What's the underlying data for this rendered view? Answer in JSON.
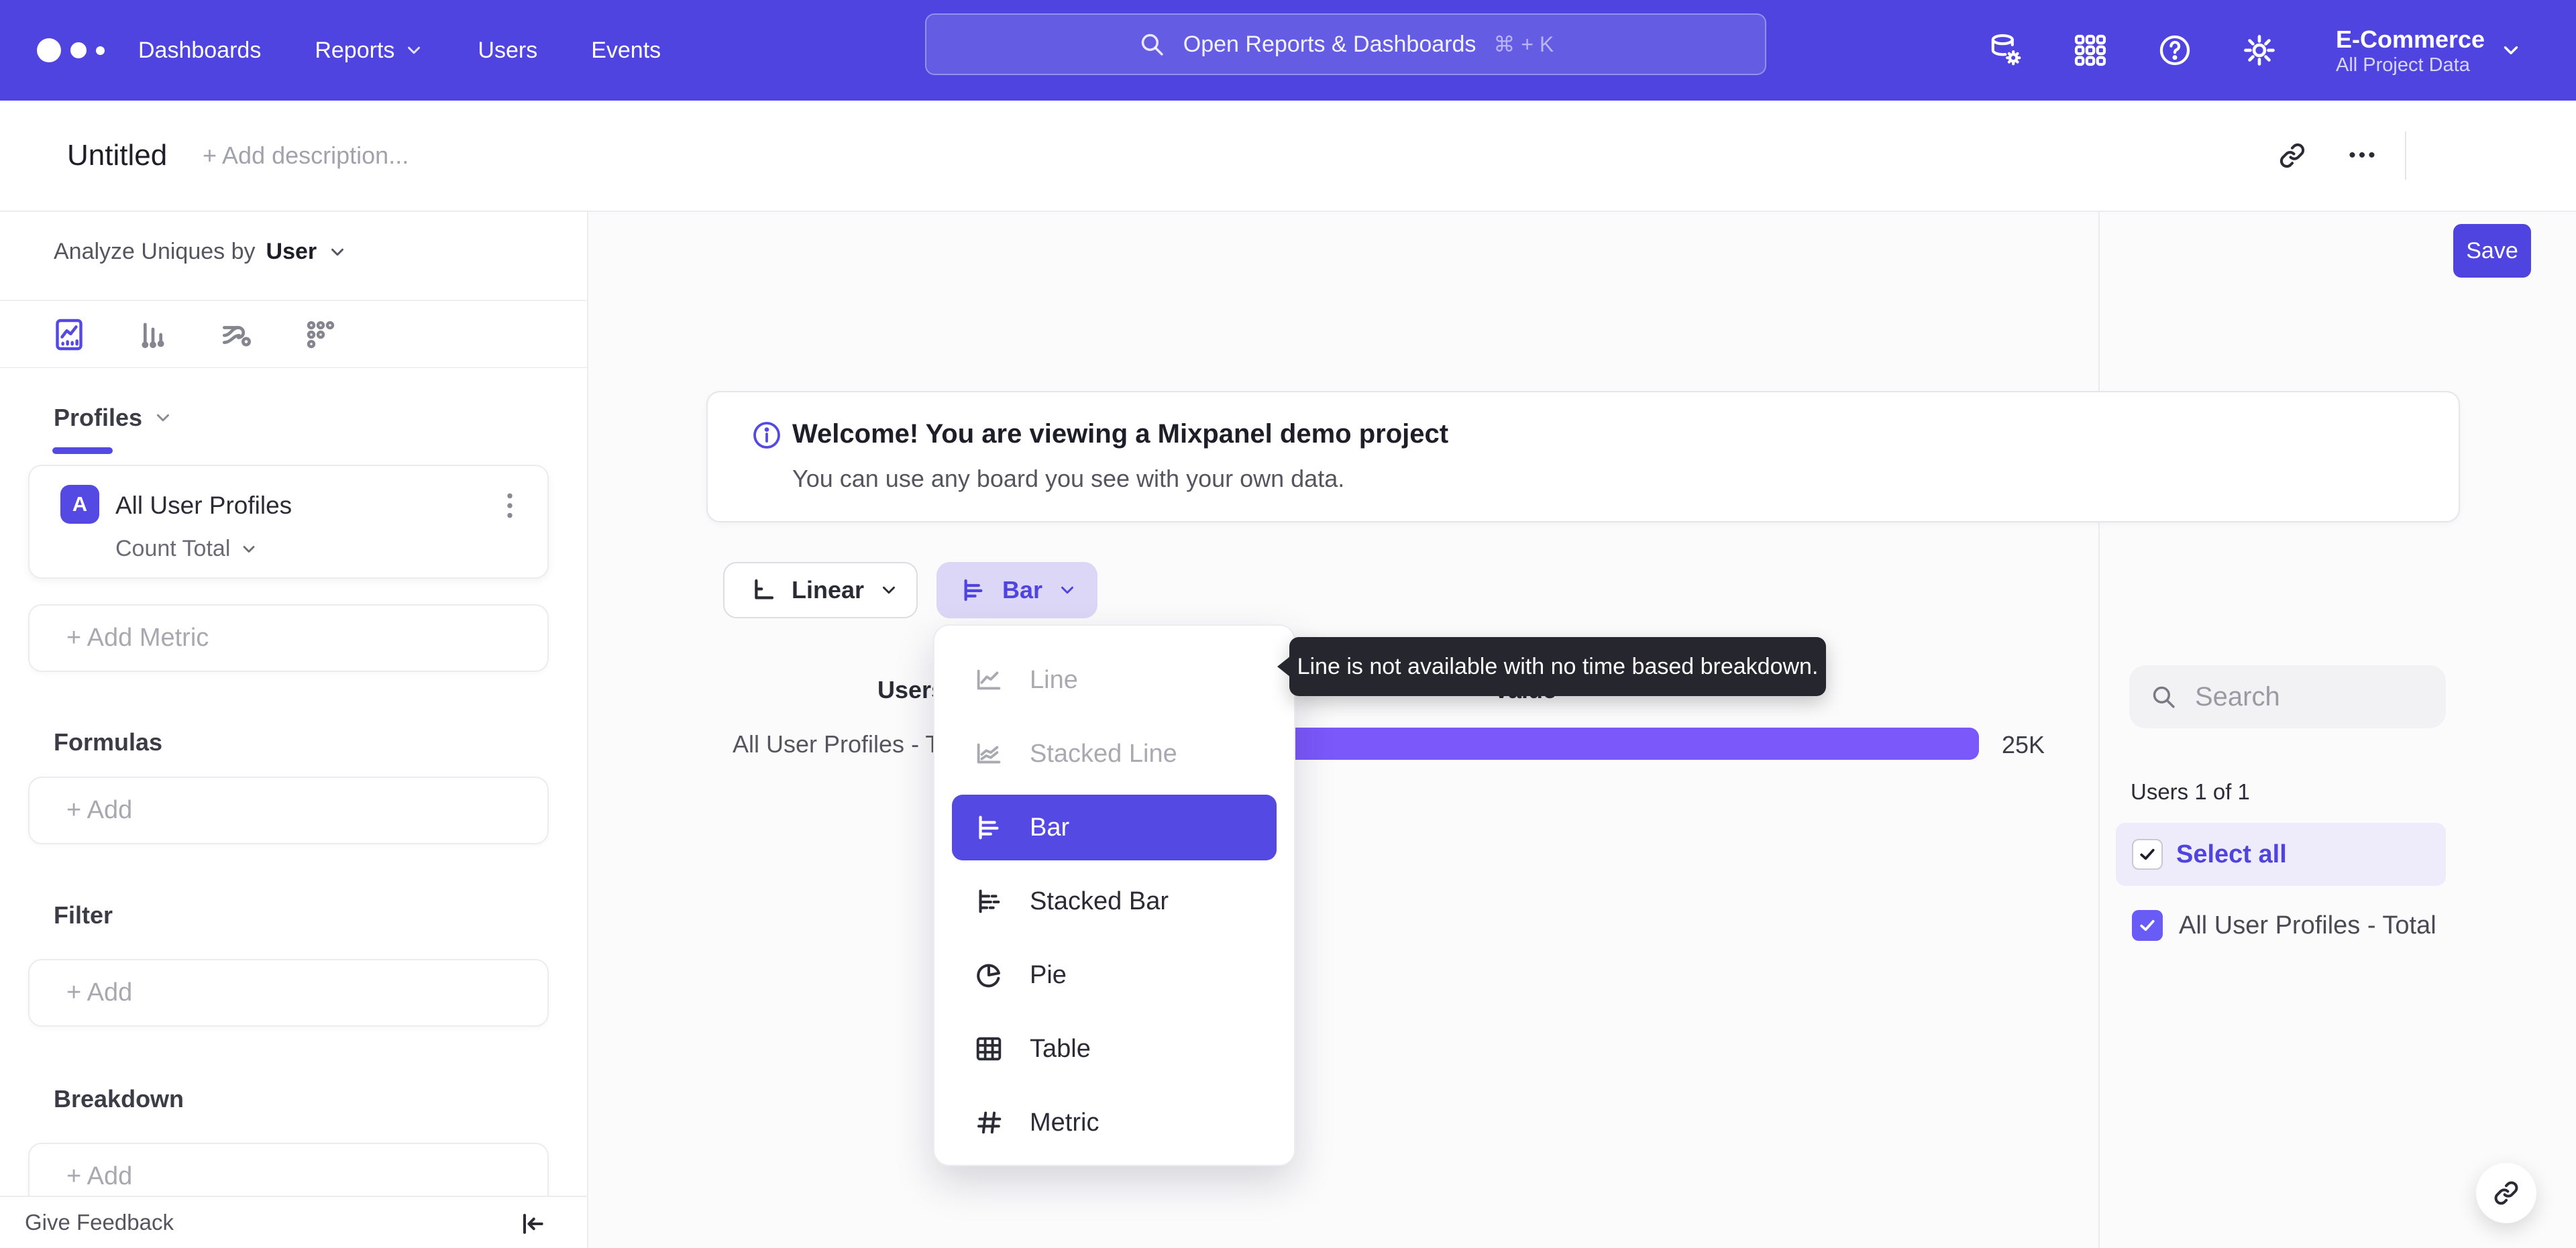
{
  "topnav": {
    "items": [
      "Dashboards",
      "Reports",
      "Users",
      "Events"
    ],
    "search_placeholder": "Open Reports & Dashboards",
    "search_shortcut": "⌘ + K",
    "icon_names": [
      "data-management-icon",
      "apps-grid-icon",
      "help-icon",
      "settings-gear-icon"
    ],
    "project_name": "E-Commerce",
    "project_scope": "All Project Data"
  },
  "header": {
    "title": "Untitled",
    "description_placeholder": "+ Add description...",
    "more_label": "•••",
    "save_label": "Save"
  },
  "sidebar": {
    "analyze_prefix": "Analyze Uniques by",
    "analyze_value": "User",
    "tab_icon_names": [
      "insights-chart-icon",
      "bar-chart-icon",
      "flows-icon",
      "retention-icon"
    ],
    "profiles_label": "Profiles",
    "metric": {
      "badge": "A",
      "name": "All User Profiles",
      "aggregation": "Count Total"
    },
    "add_metric_label": "+ Add Metric",
    "formulas_label": "Formulas",
    "filter_label": "Filter",
    "breakdown_label": "Breakdown",
    "add_label": "+ Add",
    "feedback_label": "Give Feedback"
  },
  "banner": {
    "title": "Welcome! You are viewing a Mixpanel demo project",
    "subtitle": "You can use any board you see with your own data."
  },
  "controls": {
    "scale_label": "Linear",
    "chart_type_label": "Bar"
  },
  "dropdown": {
    "items": [
      {
        "label": "Line",
        "state": "disabled"
      },
      {
        "label": "Stacked Line",
        "state": "disabled"
      },
      {
        "label": "Bar",
        "state": "selected"
      },
      {
        "label": "Stacked Bar",
        "state": "normal"
      },
      {
        "label": "Pie",
        "state": "normal"
      },
      {
        "label": "Table",
        "state": "normal"
      },
      {
        "label": "Metric",
        "state": "normal"
      }
    ]
  },
  "tooltip": {
    "text": "Line is not available with no time based breakdown."
  },
  "chart_data": {
    "type": "bar",
    "orientation": "horizontal",
    "columns": [
      "Users",
      "Value"
    ],
    "categories": [
      "All User Profiles - Total"
    ],
    "values": [
      25000
    ],
    "value_labels": [
      "25K"
    ],
    "xlim": [
      0,
      27500
    ],
    "series_color": "#7a58fa"
  },
  "right_panel": {
    "search_placeholder": "Search",
    "count_label": "Users 1 of 1",
    "select_all_label": "Select all",
    "items": [
      {
        "label": "All User Profiles - Total",
        "checked": true
      }
    ]
  },
  "colors": {
    "nav": "#4f44e0",
    "accent": "#544ae3",
    "bar": "#7a58fa",
    "tooltip_bg": "#26262e"
  }
}
